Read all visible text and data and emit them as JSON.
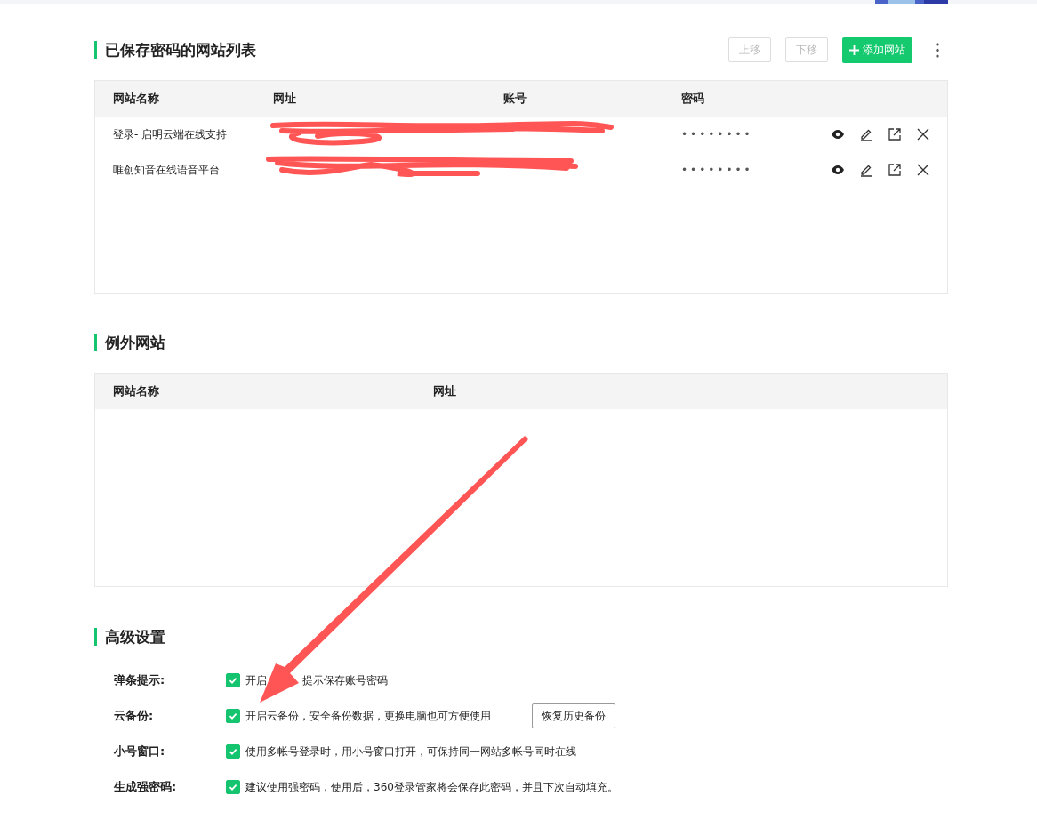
{
  "saved_sites": {
    "title": "已保存密码的网站列表",
    "move_up": {
      "label": "上移",
      "disabled": true
    },
    "move_down": {
      "label": "下移",
      "disabled": true
    },
    "add_button": "添加网站",
    "columns": [
      "网站名称",
      "网址",
      "账号",
      "密码"
    ],
    "rows": [
      {
        "name": "登录- 启明云端在线支持",
        "password": "••••••••"
      },
      {
        "name": "唯创知音在线语音平台",
        "password": "••••••••"
      }
    ]
  },
  "exceptions": {
    "title": "例外网站",
    "columns": [
      "网站名称",
      "网址"
    ]
  },
  "advanced": {
    "title": "高级设置",
    "settings": [
      {
        "label": "弹条提示:",
        "checked": true,
        "text_parts": [
          "开启",
          "提示保存账号密码"
        ]
      },
      {
        "label": "云备份:",
        "checked": true,
        "text_parts": [
          "开启云备份，安全备份数据，更换电脑也可方便使用"
        ],
        "button": "恢复历史备份"
      },
      {
        "label": "小号窗口:",
        "checked": true,
        "text_parts": [
          "使用多帐号登录时，用小号窗口打开，可保持同一网站多帐号同时在线"
        ]
      },
      {
        "label": "生成强密码:",
        "checked": true,
        "text_parts": [
          "建议使用强密码，使用后，360登录管家将会保存此密码，并且下次自动填充。"
        ]
      }
    ]
  }
}
